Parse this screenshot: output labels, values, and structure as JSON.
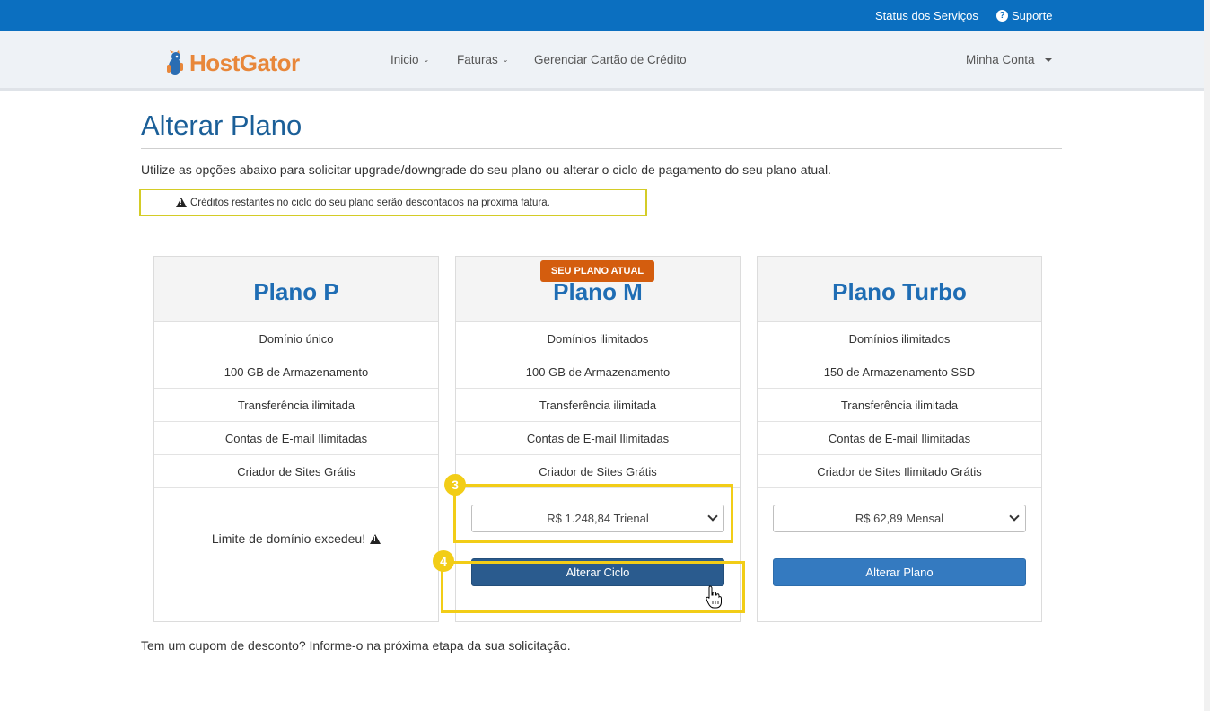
{
  "topbar": {
    "status": "Status dos Serviços",
    "support": "Suporte"
  },
  "brand": {
    "name": "HostGator",
    "color": "#e8873a"
  },
  "nav": {
    "inicio": "Inicio",
    "faturas": "Faturas",
    "cartao": "Gerenciar Cartão de Crédito",
    "account": "Minha Conta"
  },
  "page": {
    "title": "Alterar Plano",
    "intro": "Utilize as opções abaixo para solicitar upgrade/downgrade do seu plano ou alterar o ciclo de pagamento do seu plano atual.",
    "alert": "Créditos restantes no ciclo do seu plano serão descontados na proxima fatura.",
    "coupon": "Tem um cupom de desconto? Informe-o na próxima etapa da sua solicitação."
  },
  "plans": [
    {
      "name": "Plano P",
      "features": [
        "Domínio único",
        "100 GB de Armazenamento",
        "Transferência ilimitada",
        "Contas de E-mail Ilimitadas",
        "Criador de Sites Grátis"
      ],
      "limit_msg": "Limite de domínio excedeu!"
    },
    {
      "name": "Plano M",
      "badge": "SEU PLANO ATUAL",
      "features": [
        "Domínios ilimitados",
        "100 GB de Armazenamento",
        "Transferência ilimitada",
        "Contas de E-mail Ilimitadas",
        "Criador de Sites Grátis"
      ],
      "select_value": "R$ 1.248,84 Trienal",
      "button": "Alterar Ciclo"
    },
    {
      "name": "Plano Turbo",
      "features": [
        "Domínios ilimitados",
        "150 de Armazenamento SSD",
        "Transferência ilimitada",
        "Contas de E-mail Ilimitadas",
        "Criador de Sites Ilimitado Grátis"
      ],
      "select_value": "R$ 62,89 Mensal",
      "button": "Alterar Plano"
    }
  ],
  "markers": {
    "step3": "3",
    "step4": "4"
  }
}
